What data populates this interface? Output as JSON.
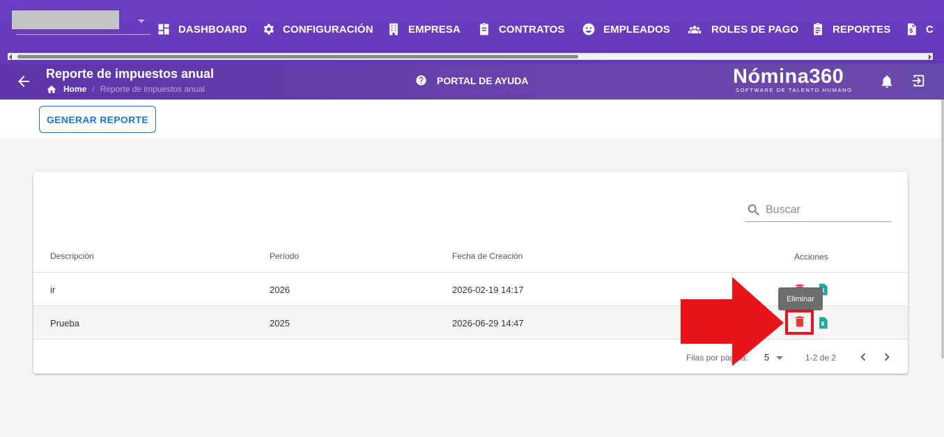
{
  "topnav": {
    "items": [
      {
        "label": "DASHBOARD",
        "icon": "dashboard-icon"
      },
      {
        "label": "CONFIGURACIÓN",
        "icon": "gear-icon"
      },
      {
        "label": "EMPRESA",
        "icon": "building-icon"
      },
      {
        "label": "CONTRATOS",
        "icon": "clipboard-icon"
      },
      {
        "label": "EMPLEADOS",
        "icon": "face-icon"
      },
      {
        "label": "ROLES DE PAGO",
        "icon": "group-icon"
      },
      {
        "label": "REPORTES",
        "icon": "report-icon"
      },
      {
        "label": "C",
        "icon": "invoice-icon"
      }
    ]
  },
  "header": {
    "title": "Reporte de impuestos anual",
    "breadcrumb": {
      "home": "Home",
      "current": "Reporte de impuestos anual"
    },
    "help": "PORTAL DE AYUDA",
    "logo_name": "Nómina360",
    "logo_tagline": "SOFTWARE DE TALENTO HUMANO"
  },
  "actions": {
    "generate": "GENERAR REPORTE"
  },
  "table": {
    "search_placeholder": "Buscar",
    "columns": [
      "Descripción",
      "Período",
      "Fecha de Creación",
      "Acciones"
    ],
    "rows": [
      {
        "descripcion": "ir",
        "periodo": "2026",
        "fecha": "2026-02-19 14:17"
      },
      {
        "descripcion": "Prueba",
        "periodo": "2025",
        "fecha": "2026-06-29 14:47"
      }
    ],
    "rows_per_page_label": "Filas por página:",
    "rows_per_page": "5",
    "range": "1-2 de 2"
  },
  "tooltip": "Eliminar",
  "colors": {
    "primary": "#673ab7",
    "accent": "#1976d2",
    "delete": "#e53935",
    "excel": "#26a69a",
    "annotation": "#e8141c"
  }
}
